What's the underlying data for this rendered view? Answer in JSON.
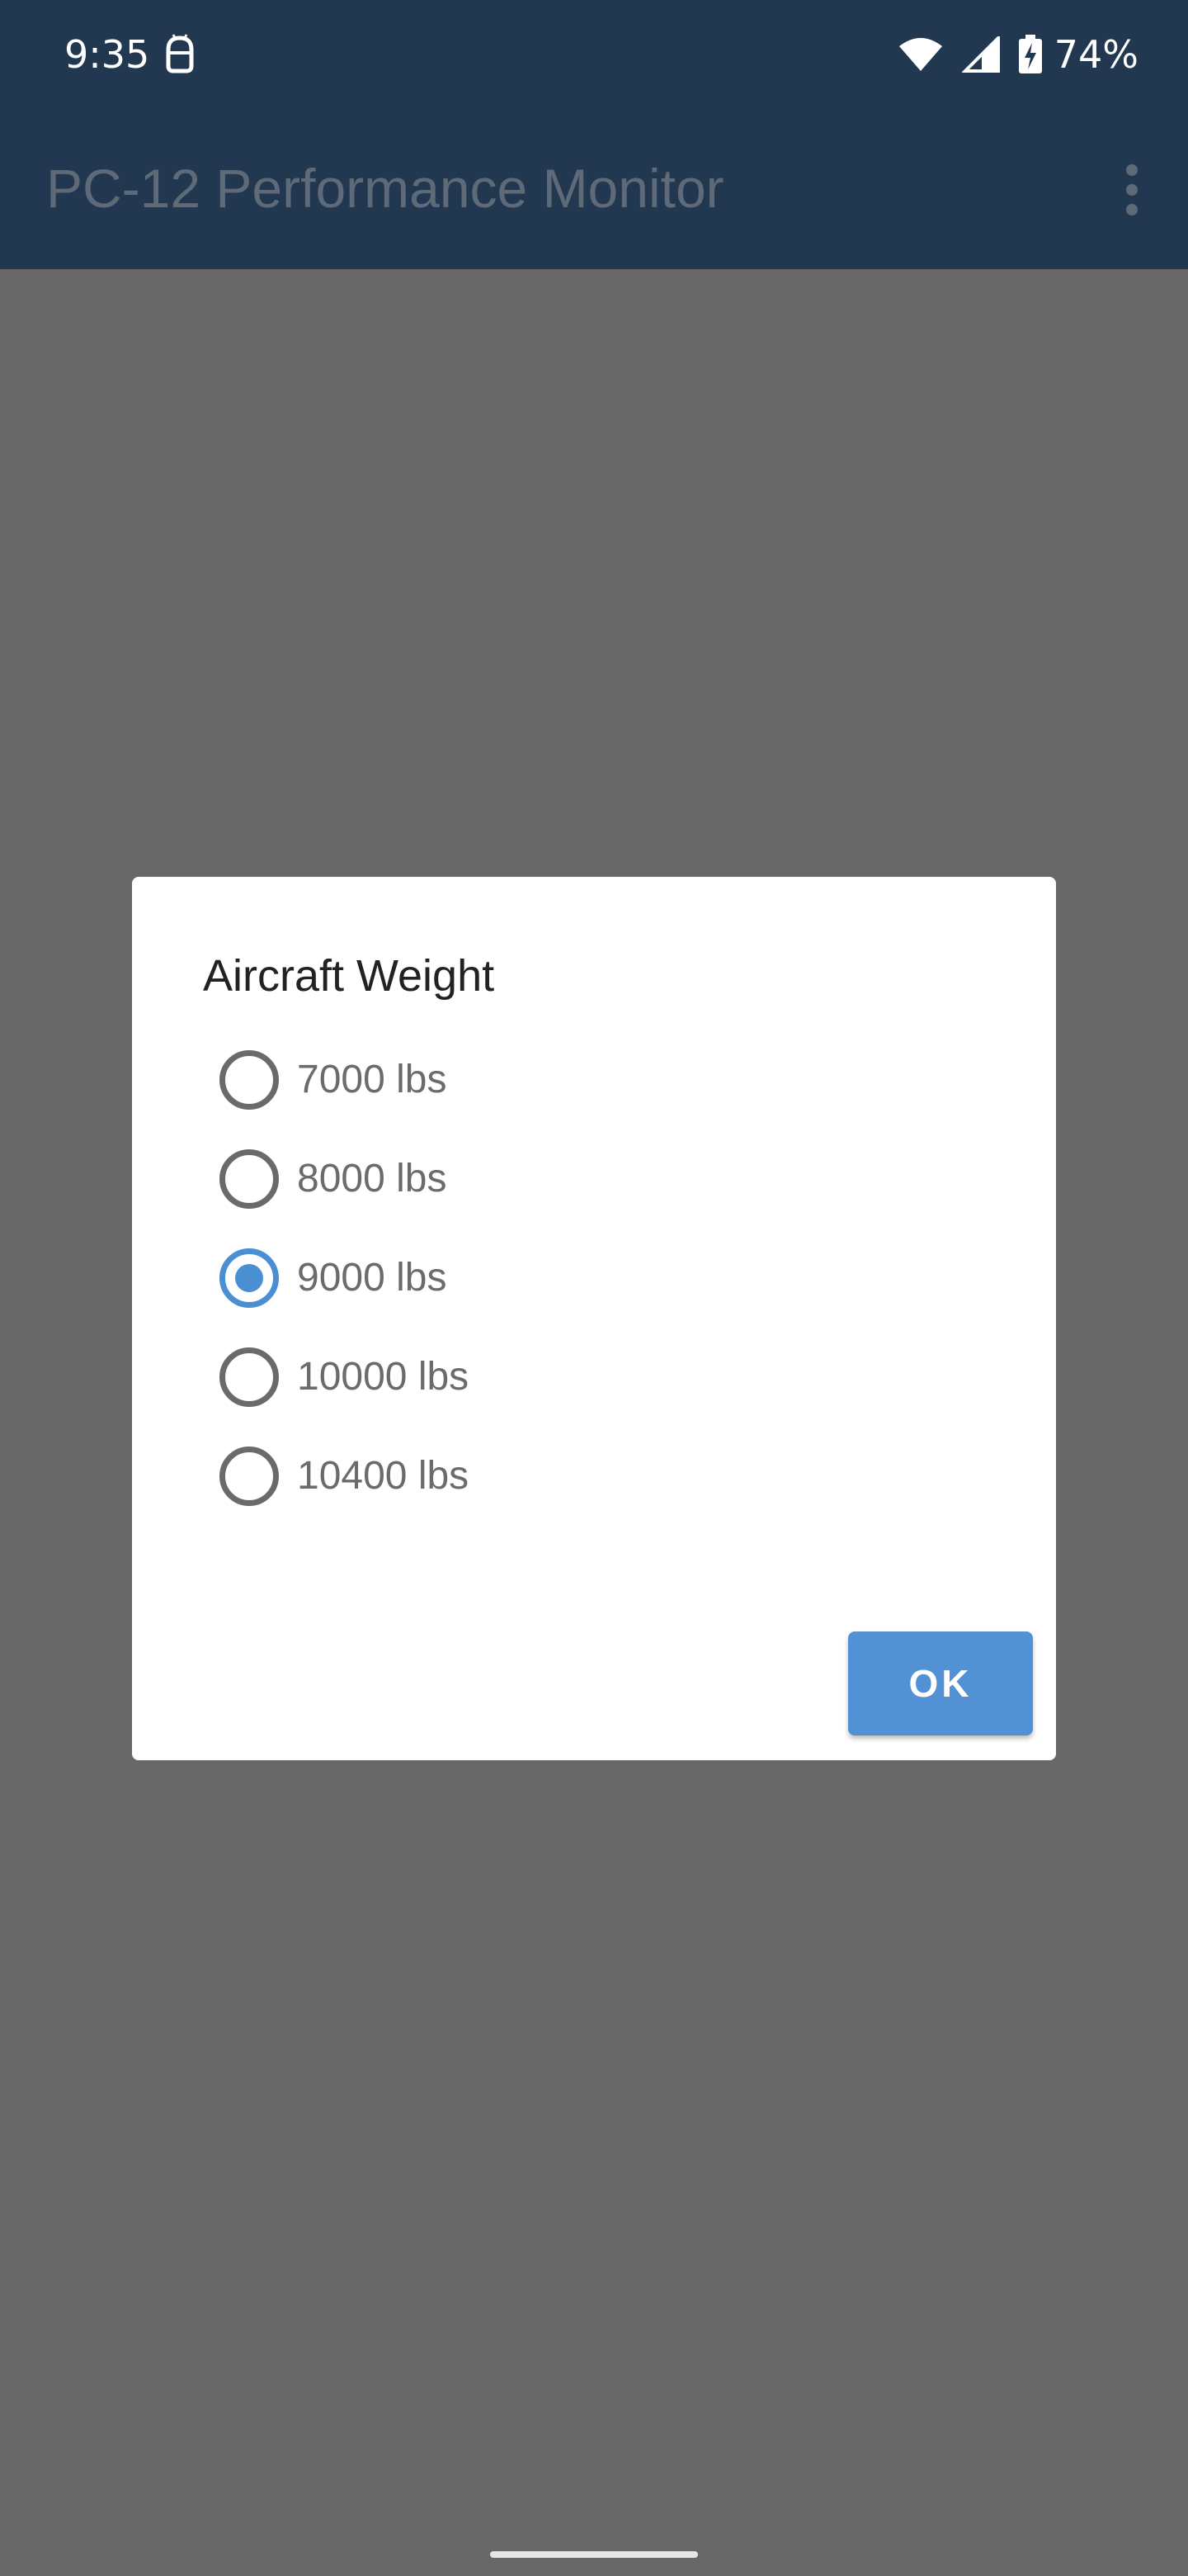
{
  "status_bar": {
    "time": "9:35",
    "battery_percent": "74%",
    "icons": [
      "android-system-icon",
      "wifi-icon",
      "signal-icon",
      "battery-charging-icon"
    ]
  },
  "app_bar": {
    "title": "PC-12 Performance Monitor",
    "menu_icon": "overflow-menu-icon"
  },
  "dialog": {
    "title": "Aircraft Weight",
    "options": [
      {
        "label": "7000 lbs",
        "selected": false
      },
      {
        "label": "8000 lbs",
        "selected": false
      },
      {
        "label": "9000 lbs",
        "selected": true
      },
      {
        "label": "10000 lbs",
        "selected": false
      },
      {
        "label": "10400 lbs",
        "selected": false
      }
    ],
    "ok_label": "OK"
  },
  "colors": {
    "status_bar_bg": "#223750",
    "scrim": "#686868",
    "accent": "#4a8fd2",
    "button": "#5292d4"
  }
}
